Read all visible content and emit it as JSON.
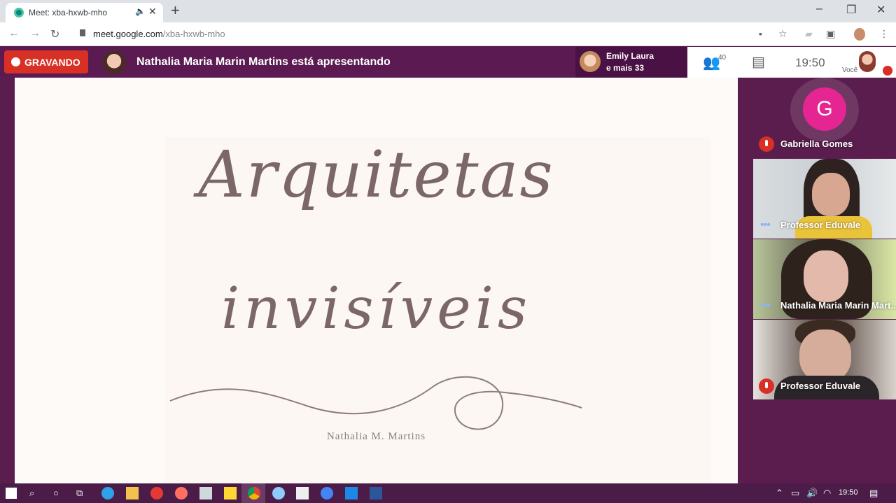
{
  "browser": {
    "tab_title": "Meet: xba-hxwb-mho",
    "tab_audio_icon": "speaker-icon",
    "tab_close": "✕",
    "new_tab": "+",
    "window_controls": [
      "–",
      "❐",
      "✕"
    ],
    "url_host": "meet.google.com",
    "url_path": "/xba-hxwb-mho"
  },
  "meet": {
    "recording_label": "GRAVANDO",
    "presenting_text": "Nathalia Maria Marin Martins está apresentando",
    "viewers_line1": "Emily Laura",
    "viewers_line2": "e mais 33",
    "people_count": "40",
    "clock": "19:50",
    "you_label": "Você"
  },
  "slide": {
    "title_line1": "Arquitetas",
    "title_line2": "invisíveis",
    "author": "Nathalia M. Martins"
  },
  "participants": [
    {
      "name": "Gabriella Gomes",
      "initial": "G",
      "muted": true
    },
    {
      "name": "Professor Eduvale",
      "muted": false
    },
    {
      "name": "Nathalia Maria Marin Mart...",
      "muted": false
    },
    {
      "name": "Professor Eduvale",
      "muted": true
    }
  ],
  "taskbar": {
    "clock": "19:50"
  },
  "colors": {
    "meet_purple": "#5b1b52",
    "record_red": "#d93025",
    "avatar_pink": "#e52592"
  }
}
